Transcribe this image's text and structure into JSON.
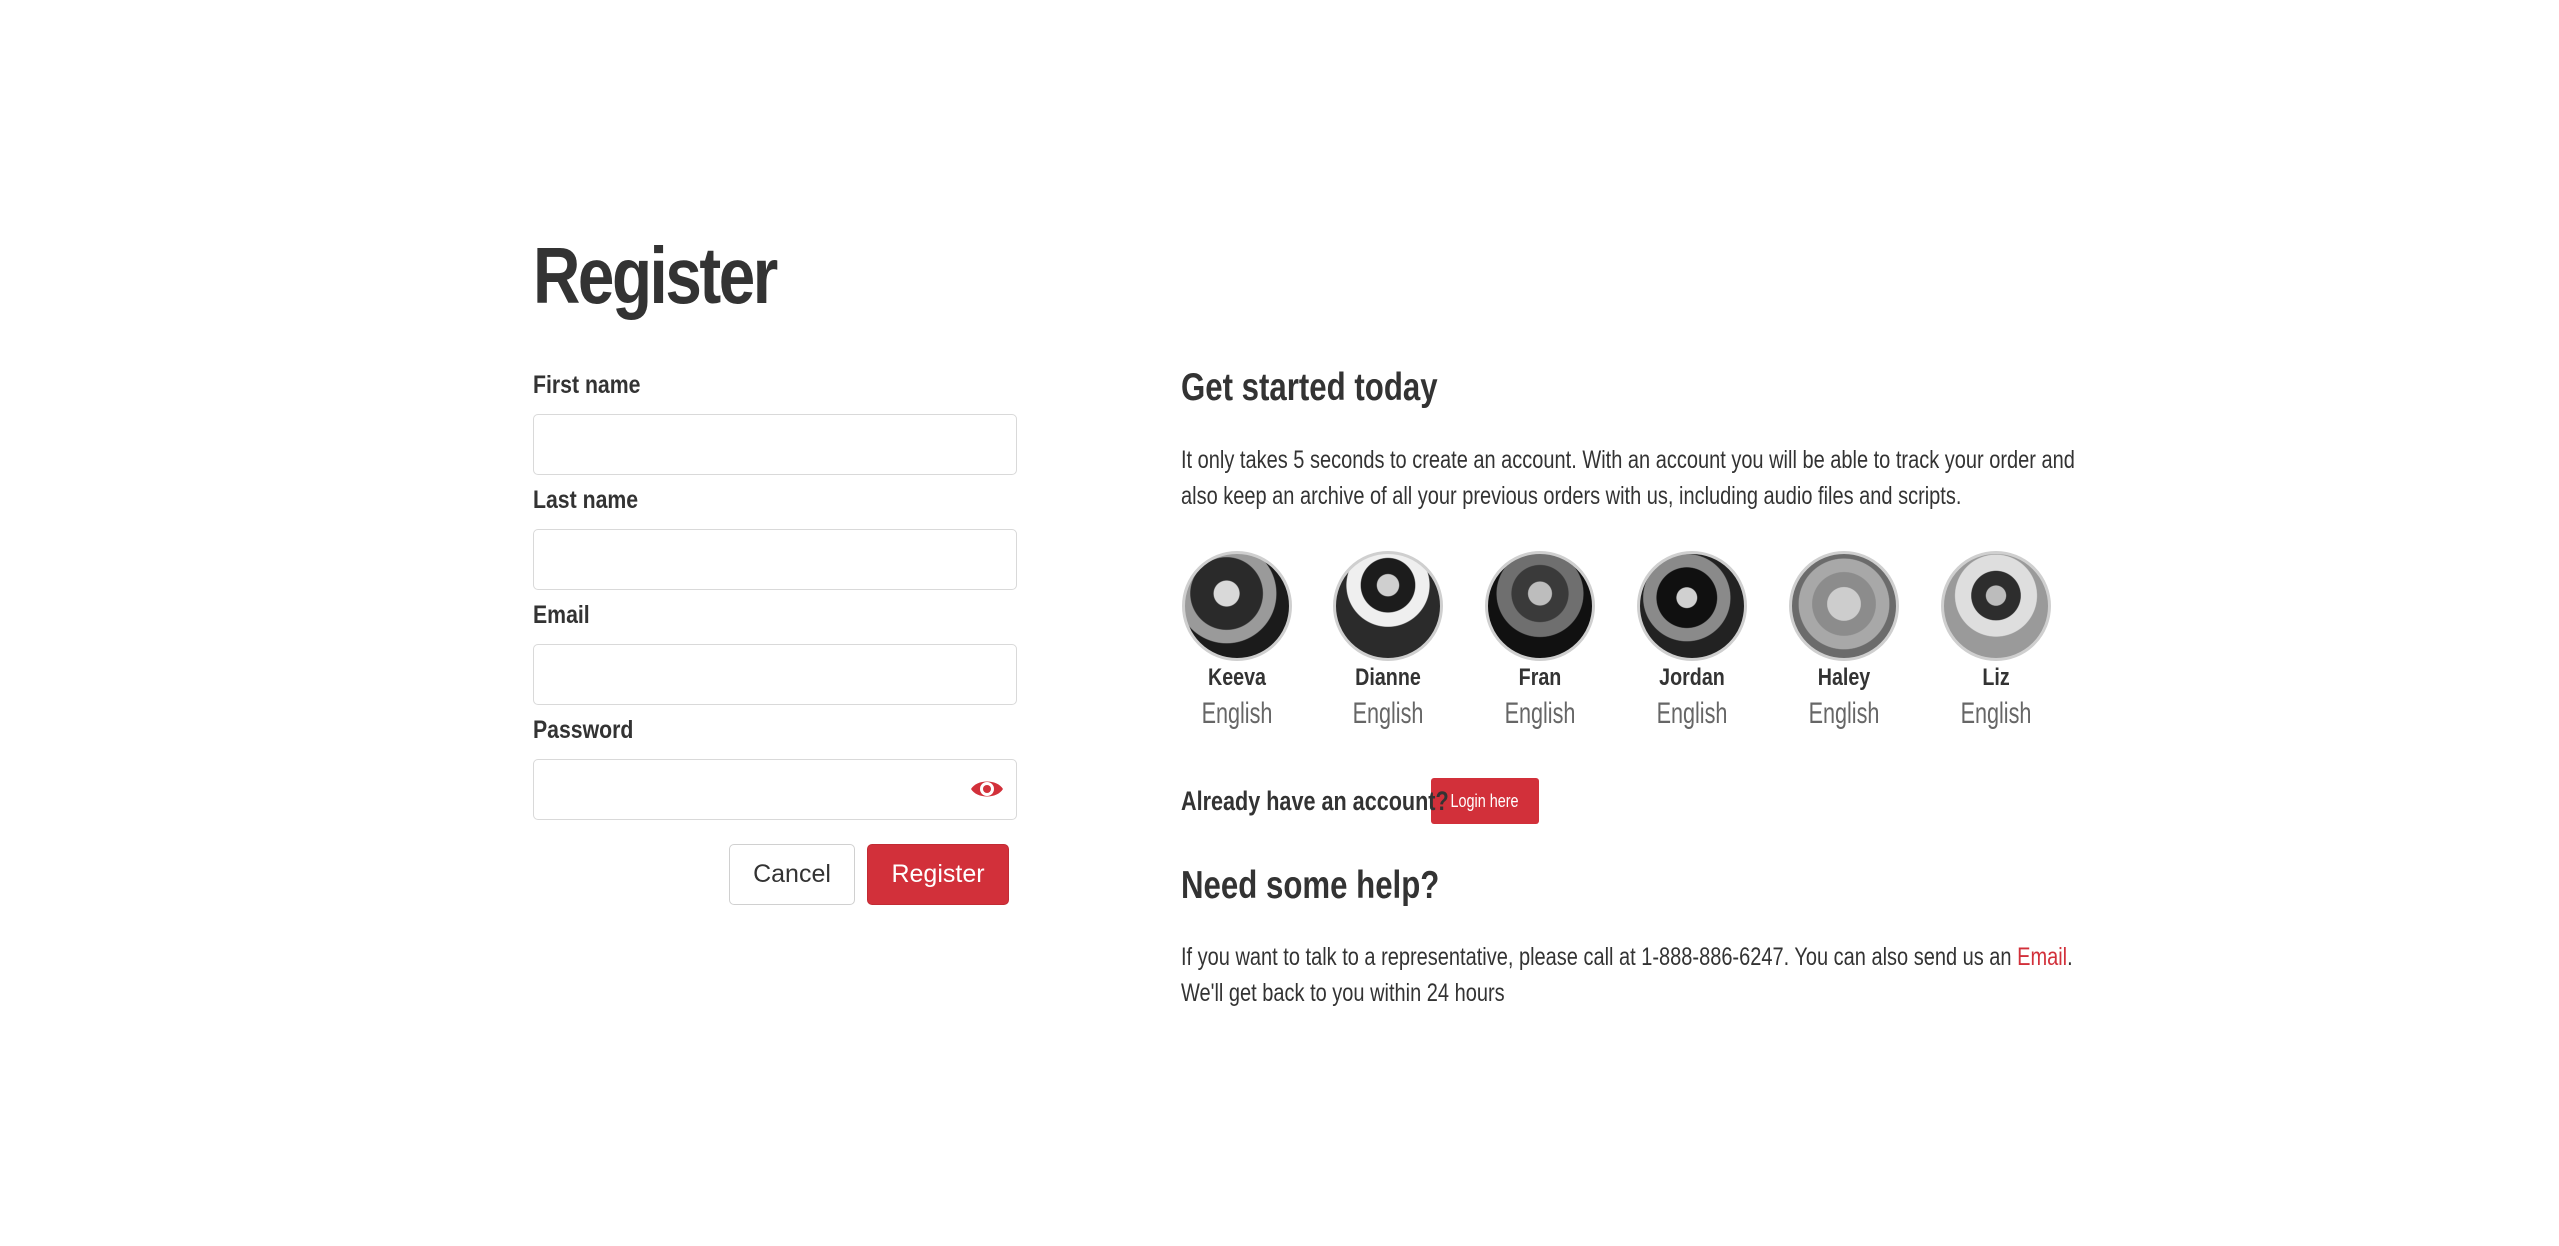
{
  "register": {
    "title": "Register",
    "fields": {
      "first_name_label": "First name",
      "last_name_label": "Last name",
      "email_label": "Email",
      "password_label": "Password",
      "first_name_value": "",
      "last_name_value": "",
      "email_value": "",
      "password_value": ""
    },
    "cancel_label": "Cancel",
    "register_label": "Register"
  },
  "info": {
    "heading": "Get started today",
    "description": "It only takes 5 seconds to create an account. With an account you will be able to track your order and also keep an archive of all your previous orders with us, including audio files and scripts.",
    "agents": [
      {
        "name": "Keeva",
        "language": "English"
      },
      {
        "name": "Dianne",
        "language": "English"
      },
      {
        "name": "Fran",
        "language": "English"
      },
      {
        "name": "Jordan",
        "language": "English"
      },
      {
        "name": "Haley",
        "language": "English"
      },
      {
        "name": "Liz",
        "language": "English"
      }
    ],
    "account_question": "Already have an account?",
    "login_label": "Login here",
    "help_heading": "Need some help?",
    "help_text_1": "If you want to talk to a representative, please call at 1-888-886-6247. You can also send us an",
    "help_link": "Email",
    "help_text_2": ". We'll get back to you within 24 hours"
  },
  "colors": {
    "accent": "#d2303a",
    "text": "#333333",
    "muted": "#666666"
  },
  "icons": {
    "password_toggle": "eye-icon"
  }
}
